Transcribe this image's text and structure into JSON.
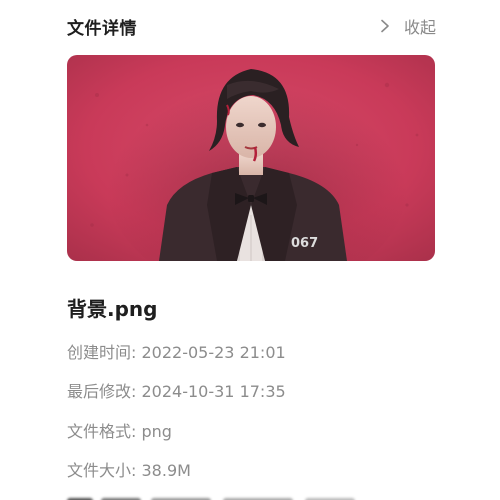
{
  "header": {
    "title": "文件详情",
    "collapse_label": "收起",
    "collapse_icon": "chevron-right-icon"
  },
  "preview": {
    "alt": "背景.png",
    "background_color": "#cf3f5e"
  },
  "file": {
    "name": "背景.png",
    "created_label": "创建时间:",
    "created_value": "2022-05-23 21:01",
    "modified_label": "最后修改:",
    "modified_value": "2024-10-31 17:35",
    "format_label": "文件格式:",
    "format_value": "png",
    "size_label": "文件大小:",
    "size_value": "38.9M"
  }
}
